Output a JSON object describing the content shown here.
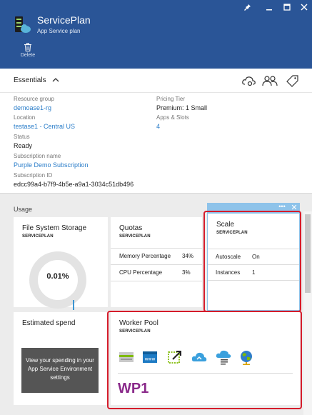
{
  "header": {
    "title": "ServicePlan",
    "subtitle": "App Service plan",
    "delete_label": "Delete",
    "color": "#2a5597"
  },
  "essentials": {
    "title": "Essentials",
    "resource_group_label": "Resource group",
    "resource_group_value": "demoase1-rg",
    "location_label": "Location",
    "location_value": "testase1 - Central US",
    "status_label": "Status",
    "status_value": "Ready",
    "subscription_name_label": "Subscription name",
    "subscription_name_value": "Purple Demo Subscription",
    "subscription_id_label": "Subscription ID",
    "subscription_id_value": "edcc99a4-b7f9-4b5e-a9a1-3034c51db496",
    "pricing_tier_label": "Pricing Tier",
    "pricing_tier_value": "Premium: 1 Small",
    "apps_slots_label": "Apps & Slots",
    "apps_slots_value": "4",
    "link_color": "#2a7dc9"
  },
  "usage": {
    "title": "Usage",
    "file_storage": {
      "title": "File System Storage",
      "subtitle": "SERVICEPLAN",
      "value": "0.01%",
      "fraction": 0.0001
    },
    "quotas": {
      "title": "Quotas",
      "subtitle": "SERVICEPLAN",
      "rows": [
        {
          "label": "Memory Percentage",
          "value": "34%"
        },
        {
          "label": "CPU Percentage",
          "value": "3%"
        }
      ]
    },
    "scale": {
      "title": "Scale",
      "subtitle": "SERVICEPLAN",
      "rows": [
        {
          "label": "Autoscale",
          "value": "On"
        },
        {
          "label": "Instances",
          "value": "1"
        }
      ]
    },
    "estimated_spend": {
      "title": "Estimated spend",
      "message": "View your spending in your App Service Environment settings"
    },
    "worker_pool": {
      "title": "Worker Pool",
      "subtitle": "SERVICEPLAN",
      "sku": "WP1",
      "icons": [
        "server-card-icon",
        "web-app-icon",
        "resize-arrow-icon",
        "cloud-sync-icon",
        "cloud-list-icon",
        "globe-icon"
      ]
    },
    "highlight_color": "#d51c2b"
  }
}
